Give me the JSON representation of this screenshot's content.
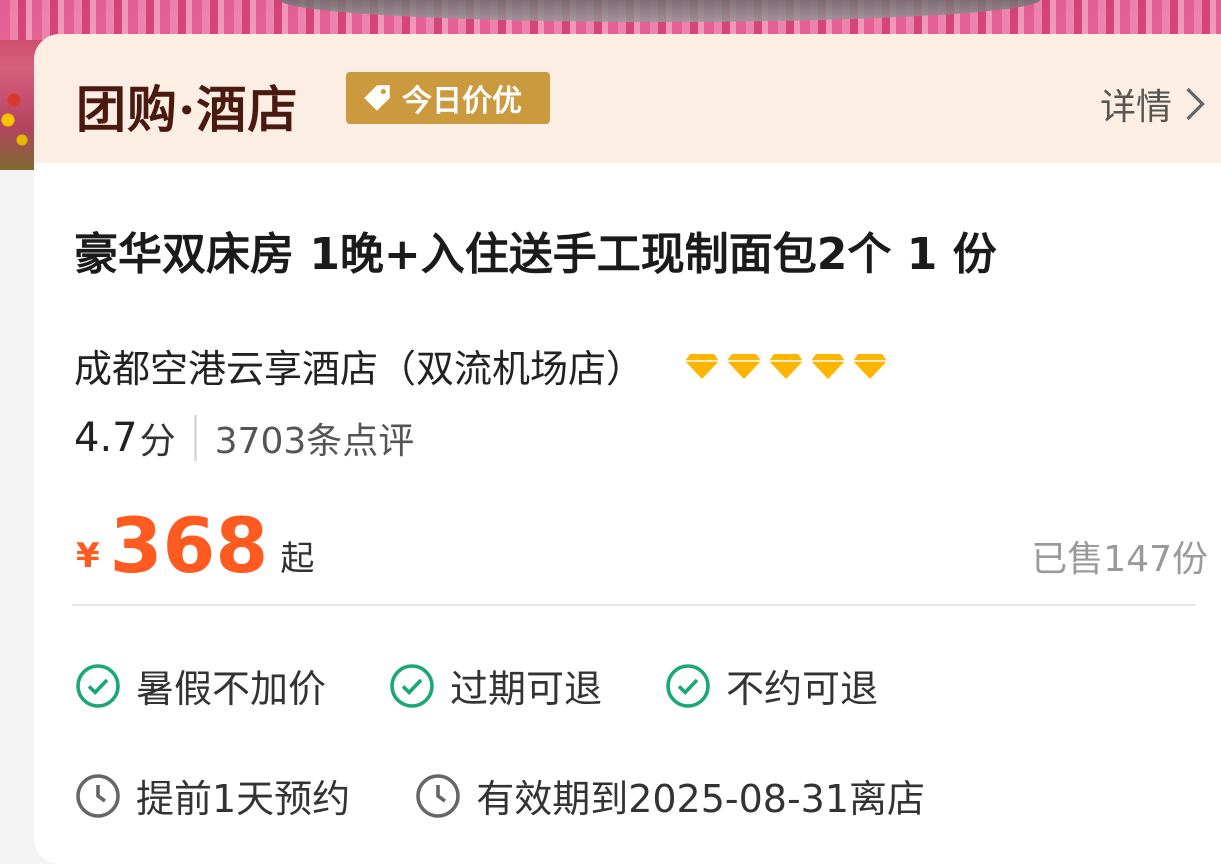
{
  "header": {
    "brand": "团购·酒店",
    "badge": "今日价优",
    "details_link": "详情"
  },
  "product": {
    "title": "豪华双床房 1晚+入住送手工现制面包2个 1 份",
    "hotel_name": "成都空港云享酒店（双流机场店）",
    "diamond_rating": 5,
    "score": "4.7",
    "score_unit": "分",
    "reviews": "3703条点评"
  },
  "pricing": {
    "currency": "¥",
    "price": "368",
    "suffix": "起",
    "sold": "已售147份"
  },
  "features": [
    {
      "label": "暑假不加价",
      "icon": "check-circle-icon"
    },
    {
      "label": "过期可退",
      "icon": "check-circle-icon"
    },
    {
      "label": "不约可退",
      "icon": "check-circle-icon"
    }
  ],
  "booking": [
    {
      "label": "提前1天预约",
      "icon": "clock-icon"
    },
    {
      "label": "有效期到2025-08-31离店",
      "icon": "clock-icon"
    }
  ],
  "colors": {
    "accent_orange": "#ff5a1f",
    "check_green": "#1aa874",
    "badge_gold": "#cc9a3e",
    "diamond_gold": "#ffb400",
    "header_bg": "#fdeee4"
  }
}
